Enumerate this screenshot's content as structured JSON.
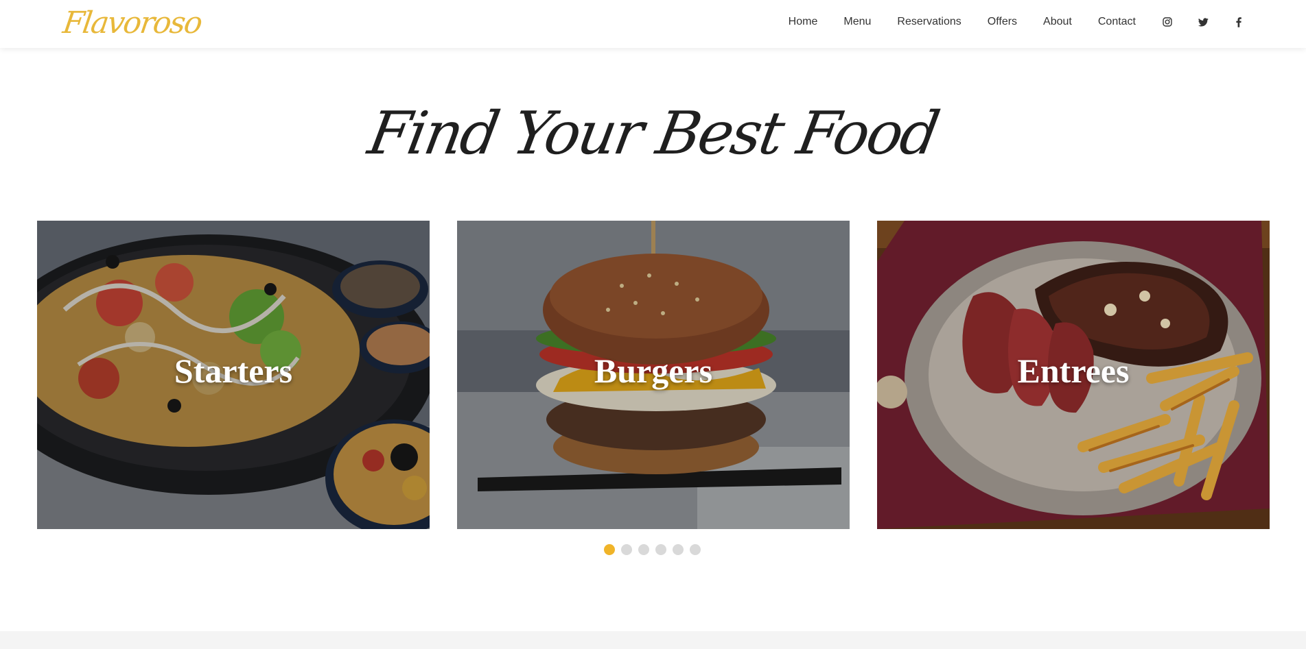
{
  "brand": {
    "logo_text": "Flavoroso",
    "accent_color": "#f0b429"
  },
  "nav": {
    "links": [
      "Home",
      "Menu",
      "Reservations",
      "Offers",
      "About",
      "Contact"
    ],
    "social_icons": [
      "instagram-icon",
      "twitter-icon",
      "facebook-icon"
    ]
  },
  "hero": {
    "heading": "Find Your Best Food"
  },
  "carousel": {
    "cards": [
      {
        "label": "Starters",
        "image": "nachos-photo"
      },
      {
        "label": "Burgers",
        "image": "burger-photo"
      },
      {
        "label": "Entrees",
        "image": "steak-fries-photo"
      }
    ],
    "page_count": 6,
    "active_page": 1
  }
}
